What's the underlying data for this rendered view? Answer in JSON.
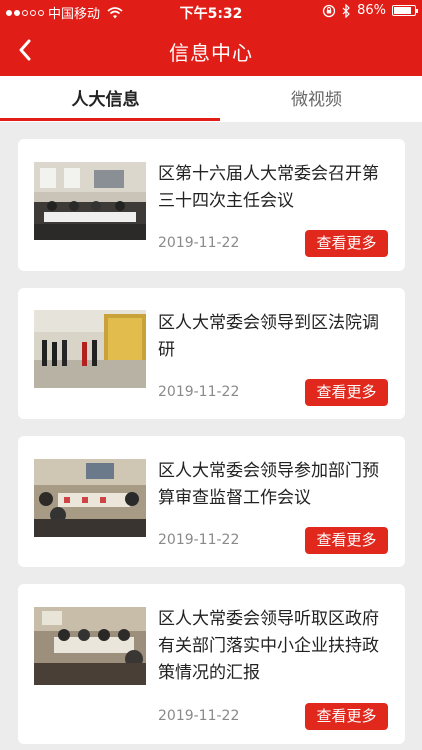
{
  "status_bar": {
    "carrier": "中国移动",
    "time": "下午5:32",
    "battery": "86%",
    "battery_level": 0.86,
    "icons": [
      "signal-dots-icon",
      "wifi-icon",
      "orientation-lock-icon",
      "bluetooth-icon",
      "battery-icon"
    ]
  },
  "nav": {
    "title": "信息中心",
    "back_icon": "chevron-left-icon"
  },
  "tabs": [
    {
      "label": "人大信息",
      "active": true
    },
    {
      "label": "微视频",
      "active": false
    }
  ],
  "colors": {
    "brand_red": "#e11d17",
    "button_red": "#e0281d",
    "background": "#ececec"
  },
  "items": [
    {
      "title": "区第十六届人大常委会召开第三十四次主任会议",
      "date": "2019-11-22",
      "button": "查看更多"
    },
    {
      "title": "区人大常委会领导到区法院调研",
      "date": "2019-11-22",
      "button": "查看更多"
    },
    {
      "title": "区人大常委会领导参加部门预算审查监督工作会议",
      "date": "2019-11-22",
      "button": "查看更多"
    },
    {
      "title": "区人大常委会领导听取区政府有关部门落实中小企业扶持政策情况的汇报",
      "date": "2019-11-22",
      "button": "查看更多"
    }
  ]
}
